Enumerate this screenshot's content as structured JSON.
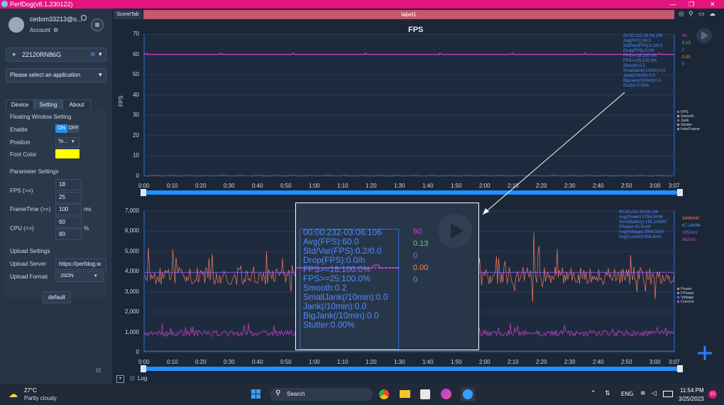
{
  "window": {
    "title": "PerfDog(v8.1.230122)",
    "controls": [
      "—",
      "❐",
      "✕"
    ]
  },
  "sidebar": {
    "account_name": "cedom33213@o...",
    "account_label": "Account",
    "device_name": "22120RN86G",
    "app_select_placeholder": "Please select an application",
    "tabs": [
      {
        "label": "Device"
      },
      {
        "label": "Setting"
      },
      {
        "label": "About"
      }
    ],
    "floating_window": {
      "header": "Floating Window Setting",
      "enable_label": "Enable",
      "on_label": "ON",
      "off_label": "OFF",
      "position_label": "Position",
      "position_value": "To...",
      "font_color_label": "Font Color",
      "font_color": "#ffff00"
    },
    "parameter": {
      "header": "Parameter Settings",
      "fps_label": "FPS (>=)",
      "fps_values": [
        "18",
        "25"
      ],
      "frametime_label": "FrameTime (>=)",
      "frametime_value": "100",
      "frametime_unit": "ms",
      "cpu_label": "CPU (<=)",
      "cpu_values": [
        "60",
        "80"
      ],
      "cpu_unit": "%"
    },
    "upload": {
      "header": "Upload Settings",
      "server_label": "Upload Server",
      "server_value": "https://perfdog.w",
      "format_label": "Upload Format",
      "format_value": "JSON"
    },
    "default_button": "default"
  },
  "scene": {
    "tab_label": "SceneTab",
    "label_title": "label1"
  },
  "chart_data": [
    {
      "type": "line",
      "title": "FPS",
      "ylabel": "FPS",
      "ylim": [
        0,
        70
      ],
      "yticks": [
        "0",
        "10",
        "20",
        "30",
        "40",
        "50",
        "60",
        "70"
      ],
      "x_ticks": [
        "0:00",
        "0:10",
        "0:20",
        "0:30",
        "0:40",
        "0:50",
        "1:00",
        "1:10",
        "1:20",
        "1:30",
        "1:40",
        "1:50",
        "2:00",
        "2:10",
        "2:20",
        "2:30",
        "2:40",
        "2:50",
        "3:00",
        "3:07"
      ],
      "series": [
        {
          "name": "FPS",
          "color": "#d040d0",
          "value": 60
        },
        {
          "name": "Smooth",
          "color": "#5bd16a",
          "value": 0.13
        },
        {
          "name": "Jank",
          "color": "#8b5cf6",
          "value": 0
        },
        {
          "name": "Stutter",
          "color": "#ff8a2a",
          "value": 0.0
        },
        {
          "name": "InterFrame",
          "color": "#4fa3ff",
          "value": 0
        }
      ],
      "stats": [
        "00:00:232-03:06:106",
        "Avg(FPS):60.0",
        "Std/Var(FPS):0.2/0.0",
        "Drop(FPS):0.0/h",
        "FPS>=18:100.0%",
        "FPS>=25:100.0%",
        "Smooth:0.2",
        "SmallJank(/10min):0.0",
        "Jank(/10min):0.0",
        "BigJank(/10min):0.0",
        "Stutter:0.00%"
      ],
      "values_text": [
        "60",
        "0.13",
        "0",
        "0.00",
        "0"
      ]
    },
    {
      "type": "line",
      "ylim": [
        0,
        7000
      ],
      "yticks": [
        "0",
        "1,000",
        "2,000",
        "3,000",
        "4,000",
        "5,000",
        "6,000",
        "7,000"
      ],
      "x_ticks": [
        "0:00",
        "0:10",
        "0:20",
        "0:30",
        "0:40",
        "0:50",
        "1:00",
        "1:10",
        "1:20",
        "1:30",
        "1:40",
        "1:50",
        "2:00",
        "2:10",
        "2:20",
        "2:30",
        "2:40",
        "2:50",
        "3:00",
        "3:07"
      ],
      "series": [
        {
          "name": "Power",
          "color": "#ff7a5c"
        },
        {
          "name": "FPower",
          "color": "#4fa3ff"
        },
        {
          "name": "Voltage",
          "color": "#8b5cf6"
        },
        {
          "name": "Current",
          "color": "#d040d0"
        }
      ],
      "stats": [
        "00:00:232-03:06:106",
        "Avg(Power):3784.5mW",
        "Sum(Battery):195.1mWH",
        "FPower:63.0mW",
        "Avg(Voltage):3956.5mV",
        "Avg(Current):956.6mA"
      ],
      "values_text": [
        "3406mW",
        "67.14mW",
        "3955mV",
        "862mA"
      ]
    }
  ],
  "overlay": {
    "stats": [
      "00:00:232-03:06:106",
      "Avg(FPS):60.0",
      "Std/Var(FPS):0.2/0.0",
      "Drop(FPS):0.0/h",
      "FPS>=18:100.0%",
      "FPS>=25:100.0%",
      "Smooth:0.2",
      "SmallJank(/10min):0.0",
      "Jank(/10min):0.0",
      "BigJank(/10min):0.0",
      "Stutter:0.00%"
    ],
    "values": [
      "60",
      "0.13",
      "0",
      "0.00",
      "0"
    ],
    "value_colors": [
      "#d040d0",
      "#5bd16a",
      "#8b5cf6",
      "#ff8a2a",
      "#4fa3ff"
    ]
  },
  "bottom": {
    "log_label": "Log"
  },
  "taskbar": {
    "weather_temp": "27°C",
    "weather_desc": "Partly cloudy",
    "search_label": "Search",
    "lang": "ENG",
    "time": "11:54 PM",
    "date": "3/25/2023",
    "badge": "15"
  }
}
